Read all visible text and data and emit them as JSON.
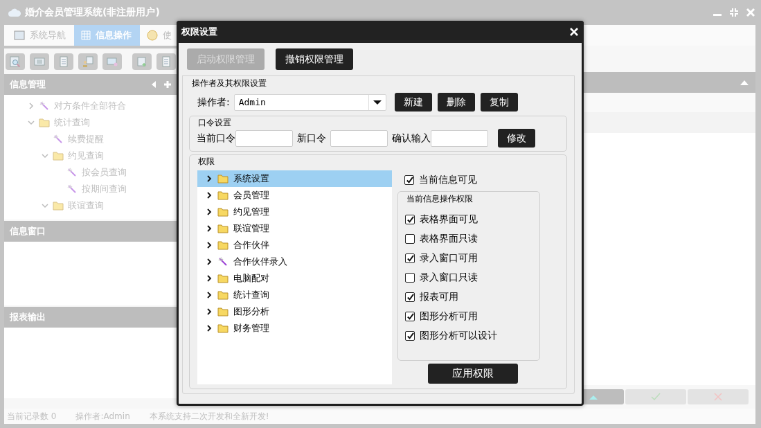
{
  "window": {
    "title": "婚介会员管理系统(非注册用户)"
  },
  "tabs": [
    {
      "label": "系统导航",
      "selected": false,
      "kind": "screen"
    },
    {
      "label": "信息操作",
      "selected": true,
      "kind": "grid"
    },
    {
      "label": "使",
      "selected": false,
      "kind": "help"
    }
  ],
  "toolbar": [
    {
      "kind": "search"
    },
    {
      "kind": "list"
    },
    {
      "kind": "document"
    },
    {
      "kind": "user"
    },
    {
      "kind": "monitor"
    },
    {
      "kind": "add"
    },
    {
      "kind": "document"
    }
  ],
  "sidebar": {
    "sections": [
      {
        "title": "信息管理",
        "tree": [
          {
            "label": "对方条件全部符合",
            "kind": "wand",
            "expanded": false
          },
          {
            "label": "统计查询",
            "kind": "folder",
            "expanded": true,
            "children": [
              {
                "label": "续费提醒",
                "kind": "wand"
              },
              {
                "label": "约见查询",
                "kind": "folder",
                "expanded": true,
                "children": [
                  {
                    "label": "按会员查询",
                    "kind": "wand"
                  },
                  {
                    "label": "按期间查询",
                    "kind": "wand"
                  }
                ]
              },
              {
                "label": "联谊查询",
                "kind": "folder",
                "expanded": true
              }
            ]
          }
        ]
      },
      {
        "title": "信息窗口"
      },
      {
        "title": "报表输出"
      }
    ]
  },
  "status_bar": [
    "当前记录数 0",
    "操作者:Admin",
    "本系统支持二次开发和全新开发!"
  ],
  "dialog": {
    "title": "权限设置",
    "top_buttons": [
      {
        "label": "启动权限管理",
        "disabled": true
      },
      {
        "label": "撤销权限管理",
        "disabled": false
      }
    ],
    "operator_group": {
      "legend": "操作者及其权限设置",
      "label": "操作者:",
      "value": "Admin",
      "buttons": [
        "新建",
        "删除",
        "复制"
      ]
    },
    "password_group": {
      "legend": "口令设置",
      "fields": [
        {
          "label": "当前口令"
        },
        {
          "label": "新口令"
        },
        {
          "label": "确认输入"
        }
      ],
      "button": "修改"
    },
    "rights_group": {
      "legend": "权限",
      "tree": [
        {
          "label": "系统设置",
          "kind": "folder",
          "selected": true
        },
        {
          "label": "会员管理",
          "kind": "folder",
          "selected": false
        },
        {
          "label": "约见管理",
          "kind": "folder",
          "selected": false
        },
        {
          "label": "联谊管理",
          "kind": "folder",
          "selected": false
        },
        {
          "label": "合作伙伴",
          "kind": "folder",
          "selected": false
        },
        {
          "label": "合作伙伴录入",
          "kind": "wand",
          "selected": false
        },
        {
          "label": "电脑配对",
          "kind": "folder",
          "selected": false
        },
        {
          "label": "统计查询",
          "kind": "folder",
          "selected": false
        },
        {
          "label": "图形分析",
          "kind": "folder",
          "selected": false
        },
        {
          "label": "财务管理",
          "kind": "folder",
          "selected": false
        }
      ],
      "visible": {
        "label": "当前信息可见",
        "checked": true
      },
      "ops_legend": "当前信息操作权限",
      "ops": [
        {
          "label": "表格界面可见",
          "checked": true
        },
        {
          "label": "表格界面只读",
          "checked": false
        },
        {
          "label": "录入窗口可用",
          "checked": true
        },
        {
          "label": "录入窗口只读",
          "checked": false
        },
        {
          "label": "报表可用",
          "checked": true
        },
        {
          "label": "图形分析可用",
          "checked": true
        },
        {
          "label": "图形分析可以设计",
          "checked": true
        }
      ],
      "apply_button": "应用权限"
    }
  }
}
